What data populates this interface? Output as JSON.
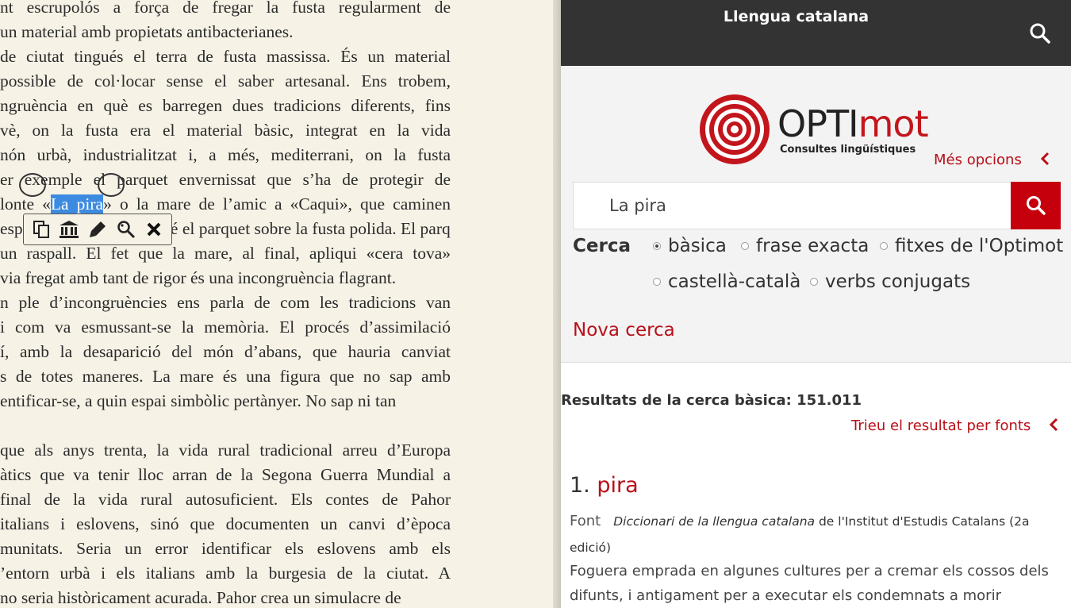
{
  "reader": {
    "lines": [
      "nt escrupolós a força de fregar la fusta regularment de",
      "un material amb propietats antibacterianes.",
      " de ciutat tingués el terra de fusta massissa. És un material",
      "possible de col·locar sense el saber artesanal. Ens trobem,",
      "ngruència en què es barregen dues tradicions diferents, fins",
      "vè, on la fusta era el material bàsic, integrat en la vida",
      "nón urbà, industrialitzat i, a més, mediterrani, on la fusta",
      "er exemple el parquet envernissat que s’ha de protegir de",
      "lonte «La pira» o la mare de l’amic a «Caqui», que caminen",
      "especials per no fer malbé el parquet sobre la fusta polida. El parquet",
      " un raspall. El fet que la mare, al final, apliqui «cera tova»",
      "via fregat amb tant de rigor és una incongruència flagrant.",
      "n ple d’incongruències ens parla de com les tradicions van",
      "i com va esmussant-se la memòria. El procés d’assimilació",
      "í, amb la desaparició del món d’abans, que hauria canviat",
      "s de totes maneres. La mare és una figura que no sap amb",
      "entificar-se, a quin espai simbòlic pertànyer. No sap ni tan",
      "",
      " que als anys trenta, la vida rural tradicional arreu d’Europa",
      "àtics que va tenir lloc arran de la Segona Guerra Mundial a",
      " final de la vida rural autosuficient. Els contes de Pahor",
      " italians i eslovens, sinó que documenten un canvi d’època",
      "munitats. Seria un error identificar els eslovens amb els",
      "’entorn urbà i els italians amb la burgesia de la ciutat. A",
      "no seria històricament acurada. Pahor crea un simulacre de"
    ],
    "selected_line_before": "lonte «",
    "selected_text": "La pira",
    "selected_line_after": "» o la mare de l’amic a «Caqui», que caminen",
    "toolbar_icons": [
      "copy-icon",
      "library-icon",
      "highlight-icon",
      "lookup-icon",
      "close-icon"
    ]
  },
  "panel": {
    "title": "Llengua catalana",
    "logo": {
      "optim": "OPTI",
      "mot": "mot",
      "subtitle": "Consultes lingüístiques"
    },
    "more_options": "Més opcions",
    "search_value": "La pira",
    "cerca_label": "Cerca",
    "options": [
      {
        "label": "bàsica",
        "selected": true
      },
      {
        "label": "frase exacta",
        "selected": false
      },
      {
        "label": "fitxes de l'Optimot",
        "selected": false
      },
      {
        "label": "castellà-català",
        "selected": false
      },
      {
        "label": "verbs conjugats",
        "selected": false
      }
    ],
    "new_search": "Nova cerca",
    "results_label": "Resultats de la cerca bàsica: 151.011",
    "sort_label": "Trieu el resultat per fonts",
    "result": {
      "number": "1.",
      "word": "pira",
      "source_label": "Font",
      "source_title": "Diccionari de la llengua catalana",
      "source_rest": " de l'Institut d'Estudis Catalans (2a edició)",
      "definition": "Foguera emprada en algunes cultures per a cremar els cossos dels difunts, i antigament per a executar els condemnats a morir cremats"
    },
    "colors": {
      "accent": "#c5000c",
      "topbar": "#333333"
    }
  }
}
